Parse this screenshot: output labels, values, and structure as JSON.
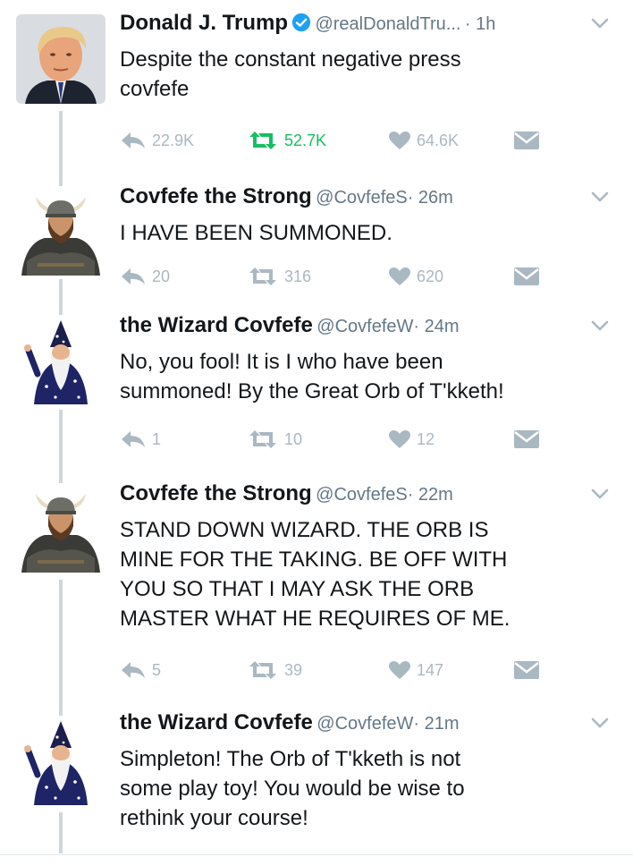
{
  "colors": {
    "meta_gray": "#657786",
    "action_gray": "#aab8c2",
    "retweet_green": "#17bf63",
    "verified_blue": "#1da1f2",
    "thread_line": "#cfd6dc"
  },
  "tweets": [
    {
      "name": "Donald J. Trump",
      "verified": true,
      "handle": "@realDonaldTru...",
      "time": "· 1h",
      "text": "Despite the constant negative press\ncovfefe",
      "avatar": "trump-avatar",
      "replies": "22.9K",
      "retweets": "52.7K",
      "likes": "64.6K",
      "retweeted": true
    },
    {
      "name": "Covfefe the Strong",
      "verified": false,
      "handle": "@CovfefeS",
      "time": "· 26m",
      "text": "I HAVE BEEN SUMMONED.",
      "avatar": "viking-avatar",
      "replies": "20",
      "retweets": "316",
      "likes": "620",
      "retweeted": false
    },
    {
      "name": "the Wizard Covfefe",
      "verified": false,
      "handle": "@CovfefeW",
      "time": "· 24m",
      "text": "No, you fool! It is I who have been\nsummoned! By the Great Orb of T'kketh!",
      "avatar": "wizard-avatar",
      "replies": "1",
      "retweets": "10",
      "likes": "12",
      "retweeted": false
    },
    {
      "name": "Covfefe the Strong",
      "verified": false,
      "handle": "@CovfefeS",
      "time": "· 22m",
      "text": "STAND DOWN WIZARD. THE ORB IS\nMINE FOR THE TAKING. BE OFF WITH\nYOU SO THAT I MAY ASK THE ORB\nMASTER WHAT HE REQUIRES OF ME.",
      "avatar": "viking-avatar",
      "replies": "5",
      "retweets": "39",
      "likes": "147",
      "retweeted": false
    },
    {
      "name": "the Wizard Covfefe",
      "verified": false,
      "handle": "@CovfefeW",
      "time": "· 21m",
      "text": "Simpleton! The Orb of T'kketh is not\nsome play toy! You would be wise to\nrethink your course!",
      "avatar": "wizard-avatar",
      "replies": null,
      "retweets": null,
      "likes": null,
      "retweeted": false
    }
  ]
}
